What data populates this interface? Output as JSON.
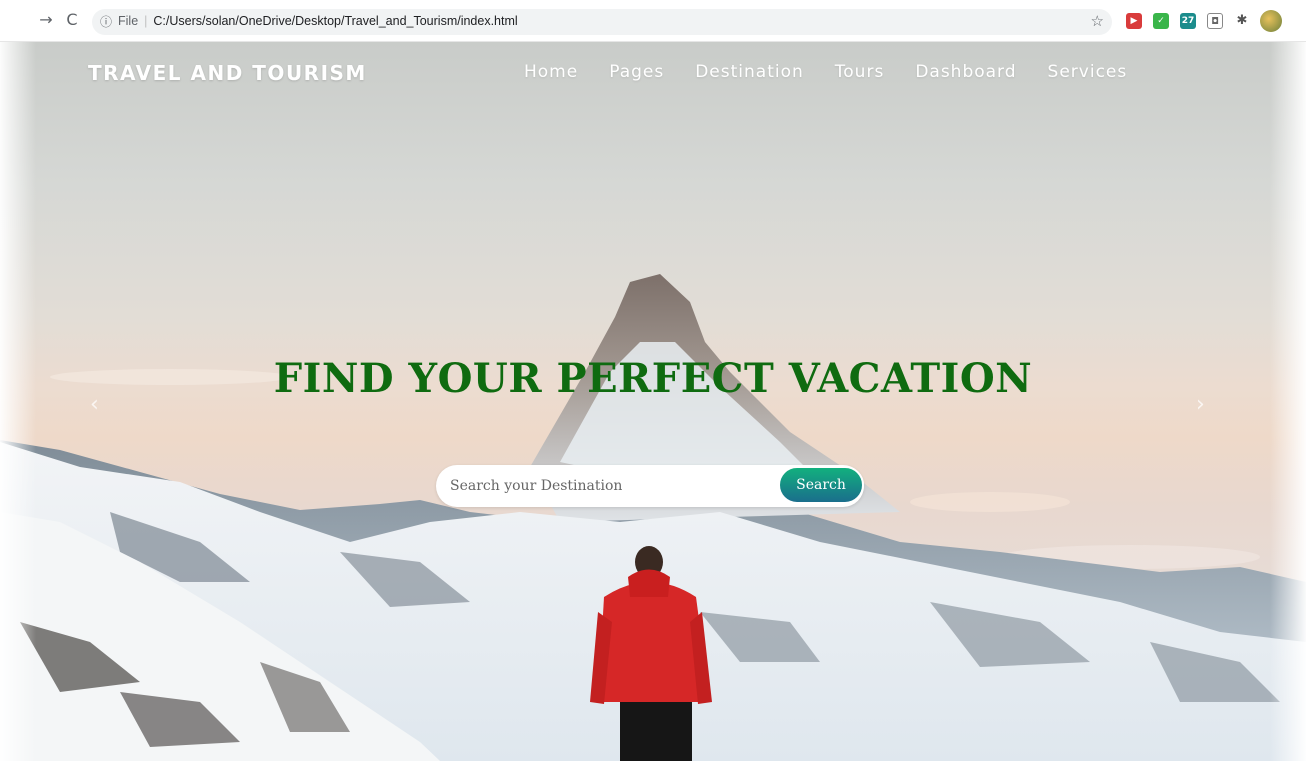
{
  "browser": {
    "back_icon": "back-arrow-icon",
    "reload_icon": "reload-icon",
    "address_scheme": "File",
    "address_url": "C:/Users/solan/OneDrive/Desktop/Travel_and_Tourism/index.html"
  },
  "site": {
    "brand": "TRAVEL AND TOURISM",
    "nav": [
      {
        "label": "Home"
      },
      {
        "label": "Pages"
      },
      {
        "label": "Destination"
      },
      {
        "label": "Tours"
      },
      {
        "label": "Dashboard"
      },
      {
        "label": "Services"
      }
    ]
  },
  "hero": {
    "headline": "FIND YOUR PERFECT VACATION",
    "search_placeholder": "Search your Destination",
    "search_button": "Search",
    "headline_color": "#0f6b10",
    "button_gradient": [
      "#12b07e",
      "#1a6e8c"
    ]
  }
}
